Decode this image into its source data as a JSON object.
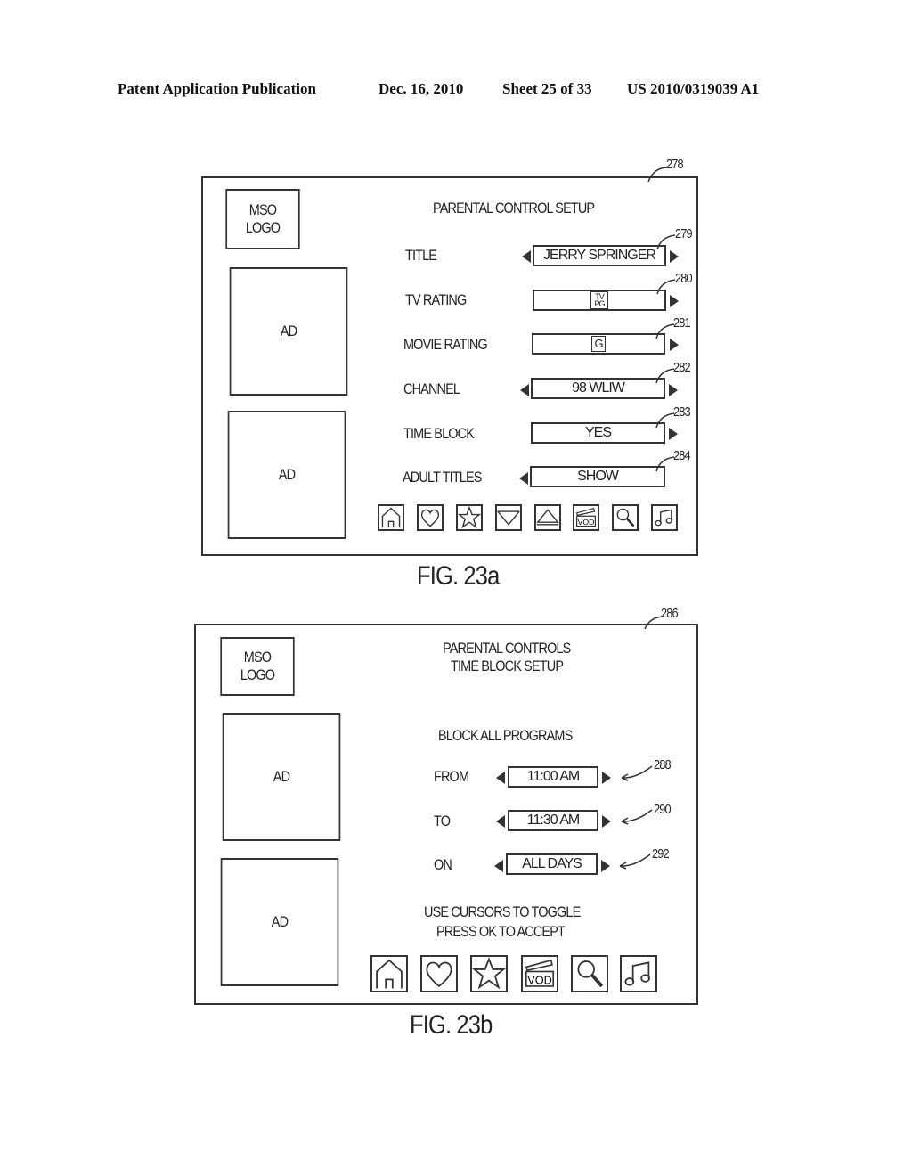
{
  "header": {
    "publication": "Patent Application Publication",
    "date": "Dec. 16, 2010",
    "sheet": "Sheet 25 of 33",
    "number": "US 2010/0319039 A1"
  },
  "fig_a": {
    "ref": "278",
    "logo": [
      "MSO",
      "LOGO"
    ],
    "ad1": "AD",
    "ad2": "AD",
    "title": "PARENTAL CONTROL SETUP",
    "rows": [
      {
        "label": "TITLE",
        "value": "JERRY SPRINGER",
        "ref": "279"
      },
      {
        "label": "TV RATING",
        "value": "TV PG",
        "ref": "280"
      },
      {
        "label": "MOVIE RATING",
        "value": "G",
        "ref": "281"
      },
      {
        "label": "CHANNEL",
        "value": "98 WLIW",
        "ref": "282"
      },
      {
        "label": "TIME BLOCK",
        "value": "YES",
        "ref": "283"
      },
      {
        "label": "ADULT TITLES",
        "value": "SHOW",
        "ref": "284"
      }
    ],
    "icons": [
      "home-icon",
      "heart-icon",
      "star-icon",
      "mail-icon",
      "eject-icon",
      "vod-clapper-icon",
      "search-icon",
      "music-icon"
    ],
    "vod_label": "VOD",
    "caption": "FIG. 23a"
  },
  "fig_b": {
    "ref": "286",
    "logo": [
      "MSO",
      "LOGO"
    ],
    "ad1": "AD",
    "ad2": "AD",
    "title": [
      "PARENTAL CONTROLS",
      "TIME BLOCK SETUP"
    ],
    "subtitle": "BLOCK ALL PROGRAMS",
    "rows": [
      {
        "label": "FROM",
        "value": "11:00 AM",
        "ref": "288"
      },
      {
        "label": "TO",
        "value": "11:30 AM",
        "ref": "290"
      },
      {
        "label": "ON",
        "value": "ALL DAYS",
        "ref": "292"
      }
    ],
    "instructions": [
      "USE CURSORS TO TOGGLE",
      "PRESS OK TO ACCEPT"
    ],
    "icons": [
      "home-icon",
      "heart-icon",
      "star-icon",
      "vod-clapper-icon",
      "search-icon",
      "music-icon"
    ],
    "vod_label": "VOD",
    "caption": "FIG. 23b"
  }
}
